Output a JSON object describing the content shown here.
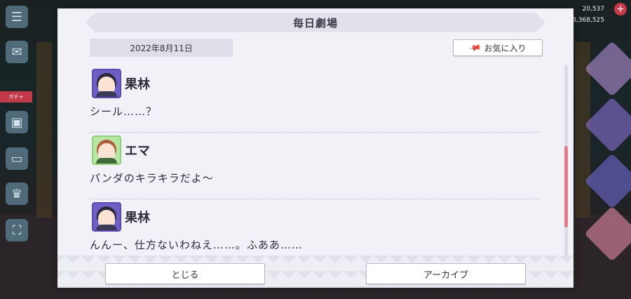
{
  "dialog": {
    "title": "毎日劇場",
    "date": "2022年8月11日",
    "favorite_label": "お気に入り",
    "entries": [
      {
        "speaker": "果林",
        "text": "シール……？",
        "avatar": "purple"
      },
      {
        "speaker": "エマ",
        "text": "パンダのキラキラだよ〜",
        "avatar": "green"
      },
      {
        "speaker": "果林",
        "text": "んんー、仕方ないわねえ……。ふああ……",
        "avatar": "purple"
      }
    ],
    "close_label": "とじる",
    "archive_label": "アーカイブ",
    "scroll_position": 0.42
  },
  "hud": {
    "resource_1": "20,537",
    "resource_2": "3,368,525",
    "left_tag": "ガチャ"
  },
  "colors": {
    "accent": "#e57c8c",
    "panel": "#f1f1f7",
    "purple_frame": "#6d5fc7",
    "green_frame": "#b8e6a4"
  }
}
